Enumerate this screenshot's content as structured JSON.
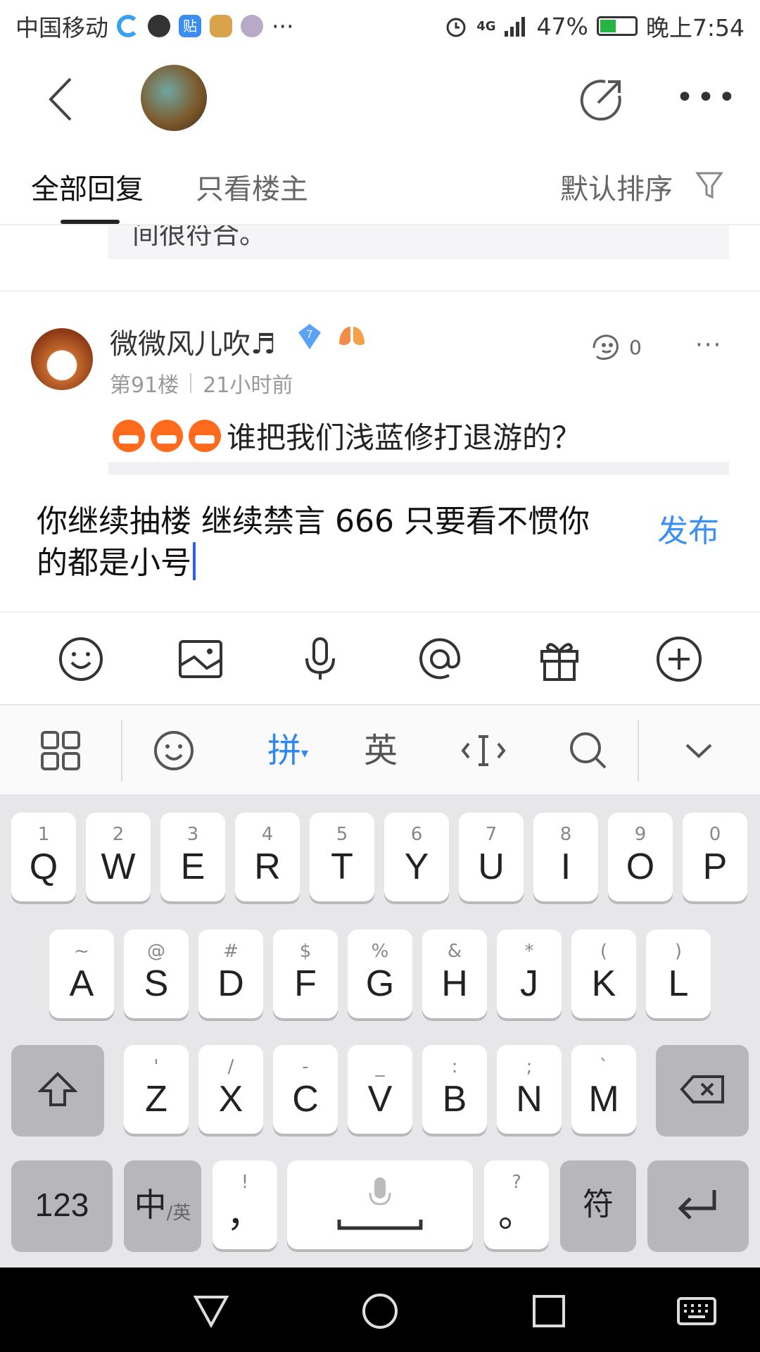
{
  "status_bar": {
    "carrier": "中国移动",
    "more": "···",
    "network": "4G",
    "battery": "47%",
    "battery_level": 0.47,
    "time": "晚上7:54"
  },
  "tabs": {
    "all_replies": "全部回复",
    "only_owner": "只看楼主",
    "sort": "默认排序"
  },
  "previous_comment": {
    "tail_text": "间很符合。"
  },
  "comment": {
    "username": "微微风儿吹♬",
    "level_badge": "7",
    "floor": "第91楼",
    "time_ago": "21小时前",
    "likes": "0",
    "more": "···",
    "text": "谁把我们浅蓝修打退游的？"
  },
  "reply": {
    "text": "你继续抽楼 继续禁言 666 只要看不惯你的都是小号",
    "publish_label": "发布"
  },
  "ime": {
    "pinyin": "拼",
    "english": "英"
  },
  "keyboard": {
    "row1": [
      {
        "main": "Q",
        "sup": "1"
      },
      {
        "main": "W",
        "sup": "2"
      },
      {
        "main": "E",
        "sup": "3"
      },
      {
        "main": "R",
        "sup": "4"
      },
      {
        "main": "T",
        "sup": "5"
      },
      {
        "main": "Y",
        "sup": "6"
      },
      {
        "main": "U",
        "sup": "7"
      },
      {
        "main": "I",
        "sup": "8"
      },
      {
        "main": "O",
        "sup": "9"
      },
      {
        "main": "P",
        "sup": "0"
      }
    ],
    "row2": [
      {
        "main": "A",
        "sup": "~"
      },
      {
        "main": "S",
        "sup": "@"
      },
      {
        "main": "D",
        "sup": "#"
      },
      {
        "main": "F",
        "sup": "$"
      },
      {
        "main": "G",
        "sup": "%"
      },
      {
        "main": "H",
        "sup": "&"
      },
      {
        "main": "J",
        "sup": "*"
      },
      {
        "main": "K",
        "sup": "("
      },
      {
        "main": "L",
        "sup": ")"
      }
    ],
    "row3": [
      {
        "main": "Z",
        "sup": "'"
      },
      {
        "main": "X",
        "sup": "/"
      },
      {
        "main": "C",
        "sup": "-"
      },
      {
        "main": "V",
        "sup": "_"
      },
      {
        "main": "B",
        "sup": ":"
      },
      {
        "main": "N",
        "sup": ";"
      },
      {
        "main": "M",
        "sup": "`"
      }
    ],
    "num_label": "123",
    "lang_label": "中",
    "lang_sub": "/英",
    "comma": "，",
    "comma_sup": "!",
    "period": "。",
    "period_sup": "?",
    "symbol_label": "符"
  },
  "colors": {
    "accent": "#3b8ff5",
    "caret": "#2f5fe4",
    "keyboard_bg": "#e7e7e9"
  }
}
